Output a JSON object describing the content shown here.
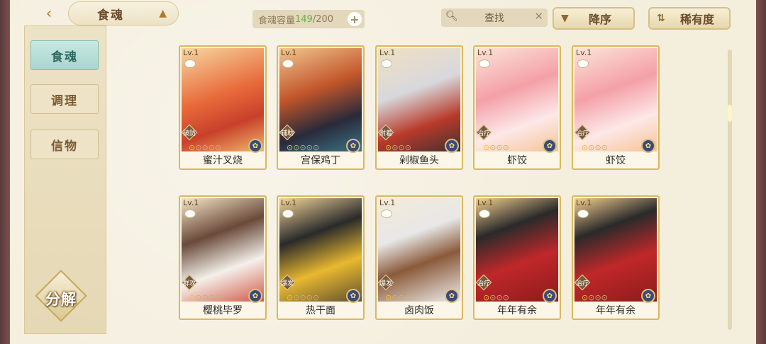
{
  "header": {
    "title": "食魂",
    "capacity_label": "食魂容量",
    "capacity_current": "149",
    "capacity_sep": "/200",
    "search_placeholder": "查找",
    "sort_order": "降序",
    "sort_key": "稀有度"
  },
  "sidebar": {
    "items": [
      {
        "label": "食魂"
      },
      {
        "label": "调理"
      },
      {
        "label": "信物"
      }
    ],
    "decompose": "分解"
  },
  "cards": [
    {
      "level": "Lv.1",
      "role": "破防",
      "name": "蜜汁叉烧",
      "stars": 5
    },
    {
      "level": "Lv.1",
      "role": "辅助",
      "name": "宫保鸡丁",
      "stars": 5
    },
    {
      "level": "Lv.1",
      "role": "附着",
      "name": "剁椒鱼头",
      "stars": 4
    },
    {
      "level": "Lv.1",
      "role": "治疗",
      "name": "虾饺",
      "stars": 4
    },
    {
      "level": "Lv.1",
      "role": "治疗",
      "name": "虾饺",
      "stars": 4
    },
    {
      "level": "Lv.1",
      "role": "群攻",
      "name": "樱桃毕罗",
      "stars": 5
    },
    {
      "level": "Lv.1",
      "role": "爆发",
      "name": "热干面",
      "stars": 5
    },
    {
      "level": "Lv.1",
      "role": "爆发",
      "name": "卤肉饭",
      "stars": 4
    },
    {
      "level": "Lv.1",
      "role": "治疗",
      "name": "年年有余",
      "stars": 4
    },
    {
      "level": "Lv.1",
      "role": "治疗",
      "name": "年年有余",
      "stars": 4
    }
  ],
  "colors": {
    "accent": "#d9b85f",
    "active_tab": "#a8d6cd",
    "capacity_current": "#6ab04c"
  }
}
